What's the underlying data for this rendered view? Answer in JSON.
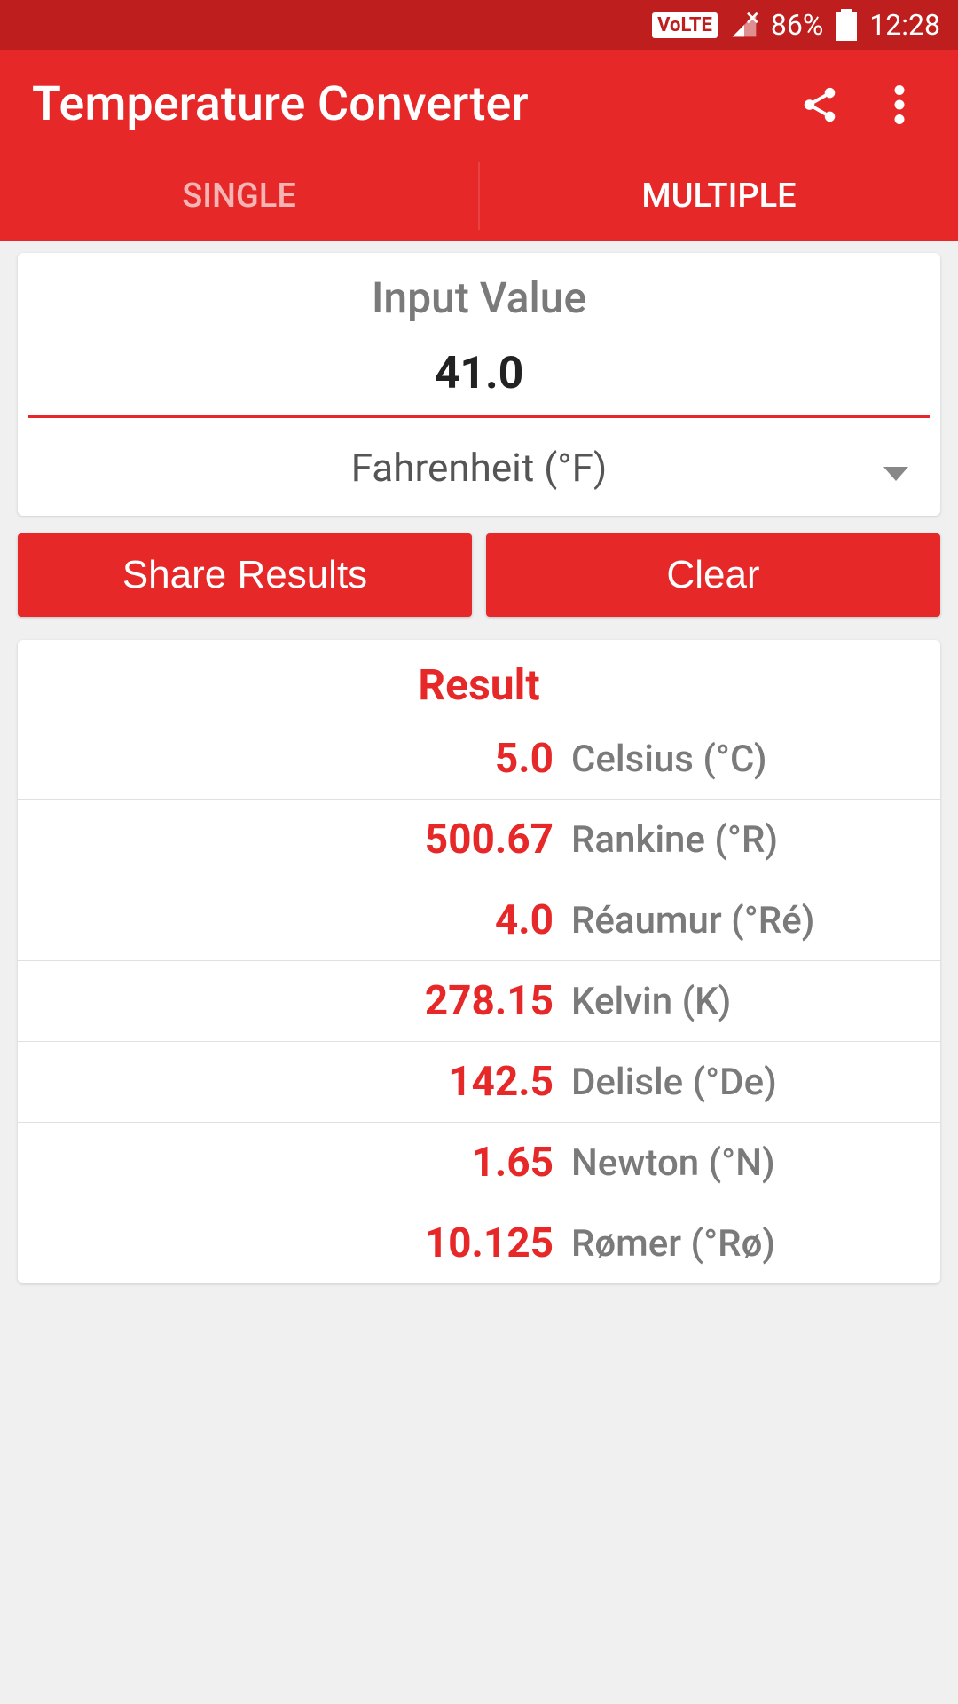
{
  "status": {
    "volte": "VoLTE",
    "battery": "86%",
    "time": "12:28"
  },
  "header": {
    "title": "Temperature Converter"
  },
  "tabs": {
    "single": "SINGLE",
    "multiple": "MULTIPLE"
  },
  "input": {
    "label": "Input Value",
    "value": "41.0",
    "unit": "Fahrenheit (°F)"
  },
  "actions": {
    "share": "Share Results",
    "clear": "Clear"
  },
  "result": {
    "header": "Result",
    "rows": [
      {
        "value": "5.0",
        "unit": "Celsius (°C)"
      },
      {
        "value": "500.67",
        "unit": "Rankine (°R)"
      },
      {
        "value": "4.0",
        "unit": "Réaumur (°Ré)"
      },
      {
        "value": "278.15",
        "unit": "Kelvin (K)"
      },
      {
        "value": "142.5",
        "unit": "Delisle (°De)"
      },
      {
        "value": "1.65",
        "unit": "Newton (°N)"
      },
      {
        "value": "10.125",
        "unit": "Rømer (°Rø)"
      }
    ]
  }
}
